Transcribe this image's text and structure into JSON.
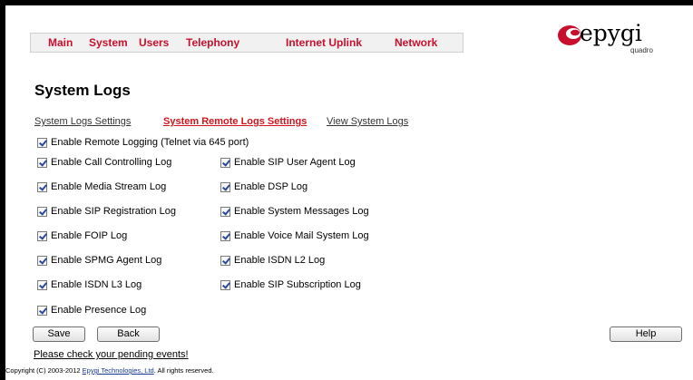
{
  "menu": {
    "items": [
      {
        "label": "Main"
      },
      {
        "label": "System"
      },
      {
        "label": "Users"
      },
      {
        "label": "Telephony"
      },
      {
        "label": "Internet Uplink"
      },
      {
        "label": "Network"
      }
    ]
  },
  "logo": {
    "brand": "epygi",
    "model": "quadro"
  },
  "page_title": "System Logs",
  "tabs": [
    {
      "label": "System Logs Settings",
      "active": false
    },
    {
      "label": "System Remote Logs Settings",
      "active": true
    },
    {
      "label": "View System Logs",
      "active": false
    }
  ],
  "remote_logging": {
    "label": "Enable Remote Logging (Telnet via 645 port)",
    "checked": true
  },
  "logs": {
    "left": [
      {
        "label": "Enable Call Controlling Log",
        "checked": true
      },
      {
        "label": "Enable Media Stream Log",
        "checked": true
      },
      {
        "label": "Enable SIP Registration Log",
        "checked": true
      },
      {
        "label": "Enable FOIP Log",
        "checked": true
      },
      {
        "label": "Enable SPMG Agent Log",
        "checked": true
      },
      {
        "label": "Enable ISDN L3 Log",
        "checked": true
      },
      {
        "label": "Enable Presence Log",
        "checked": true
      }
    ],
    "right": [
      {
        "label": "Enable SIP User Agent Log",
        "checked": true
      },
      {
        "label": "Enable DSP Log",
        "checked": true
      },
      {
        "label": "Enable System Messages Log",
        "checked": true
      },
      {
        "label": "Enable Voice Mail System Log",
        "checked": true
      },
      {
        "label": "Enable ISDN L2 Log",
        "checked": true
      },
      {
        "label": "Enable SIP Subscription Log",
        "checked": true
      }
    ]
  },
  "buttons": {
    "save": "Save",
    "back": "Back",
    "help": "Help"
  },
  "footer": {
    "pending": "Please check your pending events!",
    "copyright_prefix": "Copyright (C) 2003-2012 ",
    "copyright_link": "Epygi Technologies, Ltd",
    "copyright_suffix": ". All rights reserved."
  },
  "colors": {
    "accent": "#c8102e",
    "active_tab": "#d4141c",
    "link": "#1a3a9a"
  }
}
